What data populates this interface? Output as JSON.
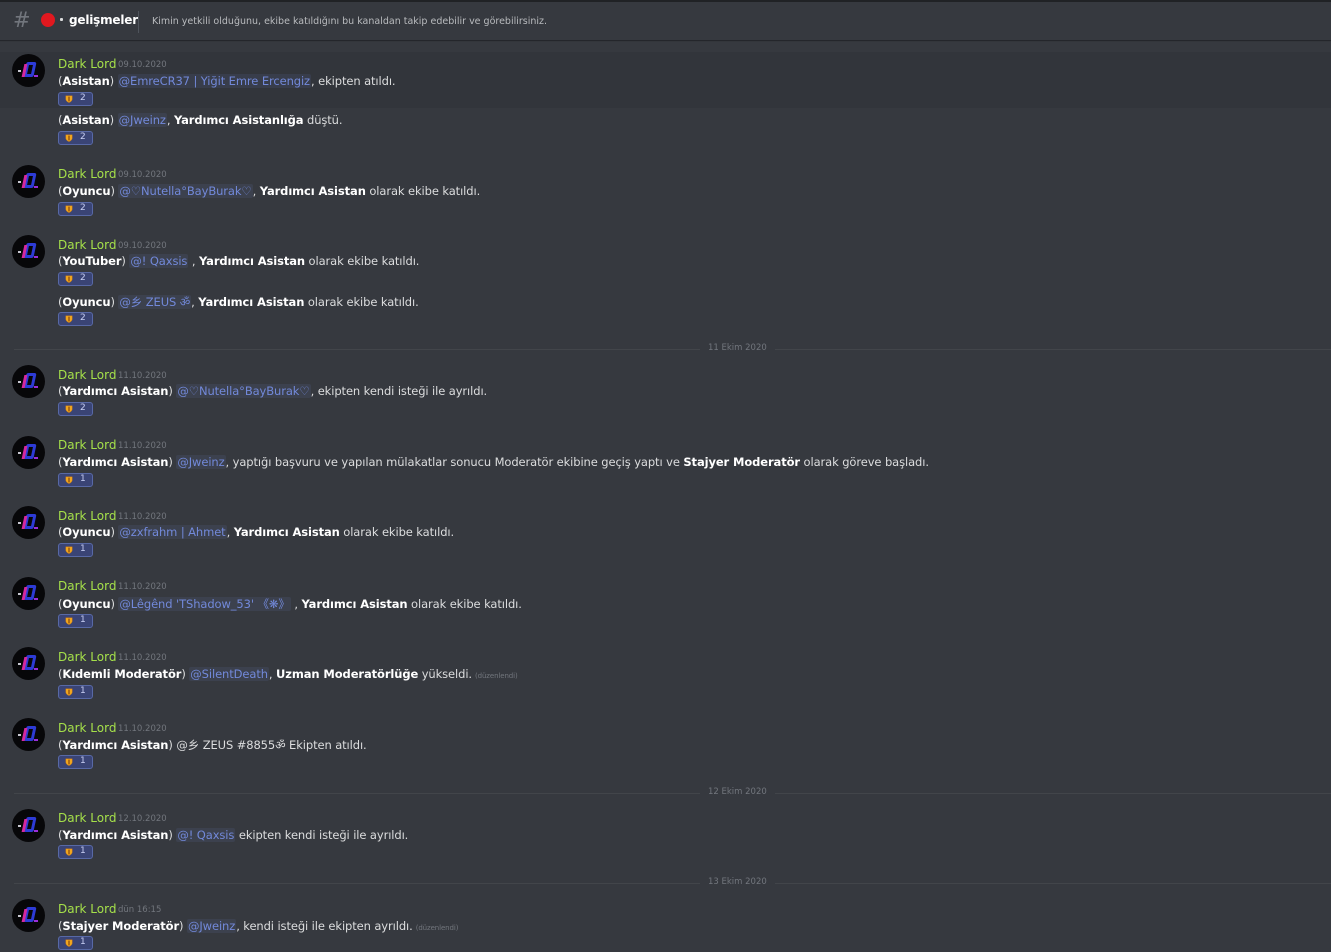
{
  "channel": {
    "hash_icon": "hash-icon",
    "status_color": "#e1181f",
    "name": "gelişmeler",
    "topic": "Kimin yetkili olduğunu, ekibe katıldığını bu kanaldan takip edebilir ve görebilirsiniz."
  },
  "author_color": "#a5e04a",
  "dividers": [
    "11 Ekim 2020",
    "12 Ekim 2020",
    "13 Ekim 2020"
  ],
  "messages": [
    {
      "author": "Dark Lord",
      "timestamp": "09.10.2020",
      "lines": [
        {
          "parts": [
            {
              "t": "(",
              "s": "plain"
            },
            {
              "t": "Asistan",
              "s": "bold"
            },
            {
              "t": ") ",
              "s": "plain"
            },
            {
              "t": "@EmreCR37 | Yiğit Emre Ercengiz",
              "s": "mention"
            },
            {
              "t": ", ekipten atıldı.",
              "s": "plain"
            }
          ],
          "reaction": "2"
        },
        {
          "parts": [
            {
              "t": "(",
              "s": "plain"
            },
            {
              "t": "Asistan",
              "s": "bold"
            },
            {
              "t": ") ",
              "s": "plain"
            },
            {
              "t": "@Jweinz",
              "s": "mention"
            },
            {
              "t": ", ",
              "s": "plain"
            },
            {
              "t": "Yardımcı Asistanlığa",
              "s": "bold"
            },
            {
              "t": " düştü.",
              "s": "plain"
            }
          ],
          "reaction": "2"
        }
      ]
    },
    {
      "author": "Dark Lord",
      "timestamp": "09.10.2020",
      "lines": [
        {
          "parts": [
            {
              "t": "(",
              "s": "plain"
            },
            {
              "t": "Oyuncu",
              "s": "bold"
            },
            {
              "t": ") ",
              "s": "plain"
            },
            {
              "t": "@♡Nutella°BayBurak♡",
              "s": "mention"
            },
            {
              "t": ", ",
              "s": "plain"
            },
            {
              "t": "Yardımcı Asistan",
              "s": "bold"
            },
            {
              "t": " olarak ekibe katıldı.",
              "s": "plain"
            }
          ],
          "reaction": "2"
        }
      ]
    },
    {
      "author": "Dark Lord",
      "timestamp": "09.10.2020",
      "lines": [
        {
          "parts": [
            {
              "t": "(",
              "s": "plain"
            },
            {
              "t": "YouTuber",
              "s": "bold"
            },
            {
              "t": ") ",
              "s": "plain"
            },
            {
              "t": "@! Qaxsis",
              "s": "mention"
            },
            {
              "t": " , ",
              "s": "plain"
            },
            {
              "t": "Yardımcı Asistan",
              "s": "bold"
            },
            {
              "t": " olarak ekibe katıldı.",
              "s": "plain"
            }
          ],
          "reaction": "2"
        },
        {
          "parts": [
            {
              "t": "(",
              "s": "plain"
            },
            {
              "t": "Oyuncu",
              "s": "bold"
            },
            {
              "t": ") ",
              "s": "plain"
            },
            {
              "t": "@乡 ZEUS ॐ",
              "s": "mention"
            },
            {
              "t": ", ",
              "s": "plain"
            },
            {
              "t": "Yardımcı Asistan",
              "s": "bold"
            },
            {
              "t": " olarak ekibe katıldı.",
              "s": "plain"
            }
          ],
          "reaction": "2"
        }
      ]
    },
    {
      "author": "Dark Lord",
      "timestamp": "11.10.2020",
      "lines": [
        {
          "parts": [
            {
              "t": "(",
              "s": "plain"
            },
            {
              "t": "Yardımcı Asistan",
              "s": "bold"
            },
            {
              "t": ") ",
              "s": "plain"
            },
            {
              "t": "@♡Nutella°BayBurak♡",
              "s": "mention"
            },
            {
              "t": ", ekipten kendi isteği ile ayrıldı.",
              "s": "plain"
            }
          ],
          "reaction": "2"
        }
      ]
    },
    {
      "author": "Dark Lord",
      "timestamp": "11.10.2020",
      "lines": [
        {
          "parts": [
            {
              "t": "(",
              "s": "plain"
            },
            {
              "t": "Yardımcı Asistan",
              "s": "bold"
            },
            {
              "t": ") ",
              "s": "plain"
            },
            {
              "t": "@Jweinz",
              "s": "mention"
            },
            {
              "t": ", yaptığı başvuru ve yapılan mülakatlar sonucu Moderatör ekibine geçiş yaptı ve ",
              "s": "plain"
            },
            {
              "t": "Stajyer Moderatör",
              "s": "bold"
            },
            {
              "t": " olarak göreve başladı.",
              "s": "plain"
            }
          ],
          "reaction": "1"
        }
      ]
    },
    {
      "author": "Dark Lord",
      "timestamp": "11.10.2020",
      "lines": [
        {
          "parts": [
            {
              "t": "(",
              "s": "plain"
            },
            {
              "t": "Oyuncu",
              "s": "bold"
            },
            {
              "t": ") ",
              "s": "plain"
            },
            {
              "t": "@zxfrahm | Ahmet",
              "s": "mention"
            },
            {
              "t": ", ",
              "s": "plain"
            },
            {
              "t": "Yardımcı Asistan",
              "s": "bold"
            },
            {
              "t": " olarak ekibe katıldı.",
              "s": "plain"
            }
          ],
          "reaction": "1"
        }
      ]
    },
    {
      "author": "Dark Lord",
      "timestamp": "11.10.2020",
      "lines": [
        {
          "parts": [
            {
              "t": "(",
              "s": "plain"
            },
            {
              "t": "Oyuncu",
              "s": "bold"
            },
            {
              "t": ") ",
              "s": "plain"
            },
            {
              "t": "@Lêgênd 'TShadow_53' 《❋》",
              "s": "mention"
            },
            {
              "t": " , ",
              "s": "plain"
            },
            {
              "t": "Yardımcı Asistan",
              "s": "bold"
            },
            {
              "t": " olarak ekibe katıldı.",
              "s": "plain"
            }
          ],
          "reaction": "1"
        }
      ]
    },
    {
      "author": "Dark Lord",
      "timestamp": "11.10.2020",
      "lines": [
        {
          "parts": [
            {
              "t": "(",
              "s": "plain"
            },
            {
              "t": "Kıdemli Moderatör",
              "s": "bold"
            },
            {
              "t": ") ",
              "s": "plain"
            },
            {
              "t": "@SilentDeath",
              "s": "mention"
            },
            {
              "t": ", ",
              "s": "plain"
            },
            {
              "t": "Uzman Moderatörlüğe",
              "s": "bold"
            },
            {
              "t": " yükseldi.",
              "s": "plain"
            },
            {
              "t": "(düzenlendi)",
              "s": "edited"
            }
          ],
          "reaction": "1"
        }
      ]
    },
    {
      "author": "Dark Lord",
      "timestamp": "11.10.2020",
      "lines": [
        {
          "parts": [
            {
              "t": "(",
              "s": "plain"
            },
            {
              "t": "Yardımcı Asistan",
              "s": "bold"
            },
            {
              "t": ") @乡 ZEUS #8855ॐ Ekipten atıldı.",
              "s": "plain"
            }
          ],
          "reaction": "1"
        }
      ]
    },
    {
      "author": "Dark Lord",
      "timestamp": "12.10.2020",
      "lines": [
        {
          "parts": [
            {
              "t": "(",
              "s": "plain"
            },
            {
              "t": "Yardımcı Asistan",
              "s": "bold"
            },
            {
              "t": ") ",
              "s": "plain"
            },
            {
              "t": "@! Qaxsis",
              "s": "mention"
            },
            {
              "t": " ekipten kendi isteği ile ayrıldı.",
              "s": "plain"
            }
          ],
          "reaction": "1"
        }
      ]
    },
    {
      "author": "Dark Lord",
      "timestamp": "dün 16:15",
      "lines": [
        {
          "parts": [
            {
              "t": "(",
              "s": "plain"
            },
            {
              "t": "Stajyer Moderatör",
              "s": "bold"
            },
            {
              "t": ") ",
              "s": "plain"
            },
            {
              "t": "@Jweinz",
              "s": "mention"
            },
            {
              "t": ", kendi isteği ile ekipten ayrıldı.",
              "s": "plain"
            },
            {
              "t": "(düzenlendi)",
              "s": "edited"
            }
          ],
          "reaction": "1"
        }
      ]
    }
  ]
}
